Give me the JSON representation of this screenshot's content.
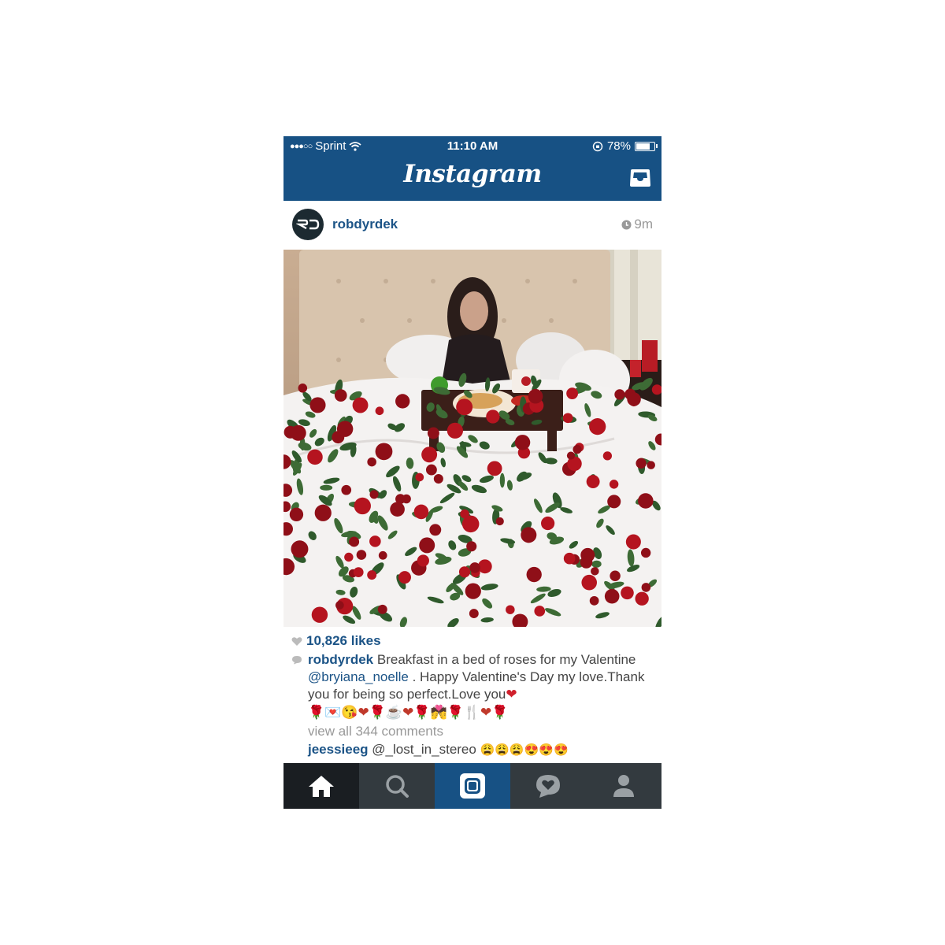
{
  "status_bar": {
    "signal": "●●●○○",
    "carrier": "Sprint",
    "time": "11:10 AM",
    "battery_text": "78%",
    "battery_level": 0.78
  },
  "header": {
    "logo": "Instagram"
  },
  "post": {
    "avatar_text": "RD",
    "username": "robdyrdek",
    "time": "9m",
    "likes": "10,826 likes",
    "caption": {
      "username": "robdyrdek",
      "text_1": " Breakfast in a bed of roses for my Valentine ",
      "mention": "@bryiana_noelle",
      "text_2": " . Happy Valentine's Day my love.Thank you for being so perfect.Love you",
      "heart": "❤",
      "emoji_line": "🌹💌😘❤🌹☕❤🌹💏🌹🍴❤🌹"
    },
    "view_all": "view all 344 comments",
    "comment": {
      "username": "jeessieeg",
      "text": " @_lost_in_stereo ",
      "emojis": "😩😩😩😍😍😍"
    }
  },
  "tabs": [
    {
      "name": "home-icon"
    },
    {
      "name": "search-icon"
    },
    {
      "name": "camera-icon"
    },
    {
      "name": "activity-icon"
    },
    {
      "name": "profile-icon"
    }
  ],
  "colors": {
    "brand": "#175184",
    "link": "#1c5487",
    "tabbar": "#333a3f"
  }
}
